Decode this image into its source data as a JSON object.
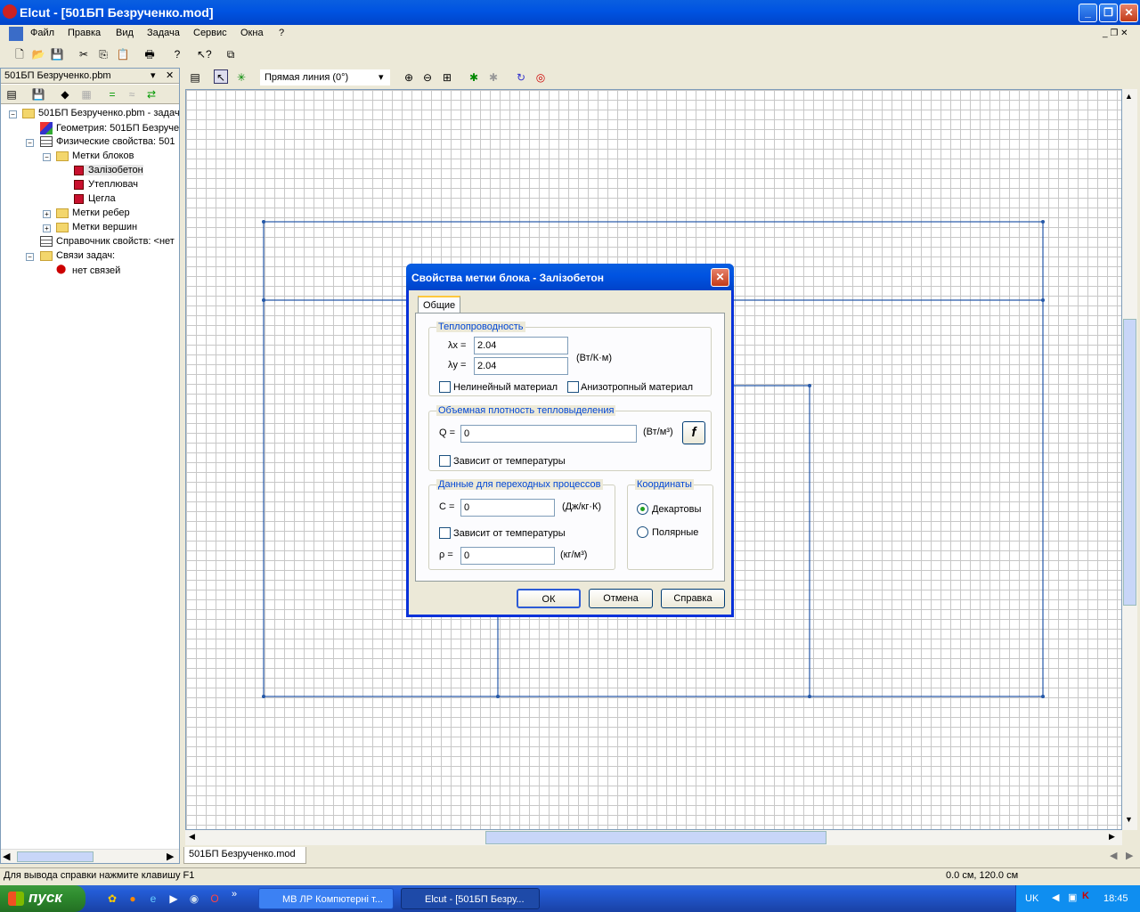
{
  "window": {
    "title": "Elcut - [501БП Безрученко.mod]",
    "min": "0",
    "max": "1",
    "close": "r"
  },
  "menu": [
    "Файл",
    "Правка",
    "Вид",
    "Задача",
    "Сервис",
    "Окна",
    "?"
  ],
  "tree": {
    "header": "501БП Безрученко.pbm",
    "items": [
      "501БП Безрученко.pbm - задач",
      "Геометрия: 501БП Безруче",
      "Физические свойства: 501",
      "Метки блоков",
      "Залізобетон",
      "Утеплювач",
      "Цегла",
      "Метки ребер",
      "Метки вершин",
      "Справочник свойств: <нет",
      "Связи задач:",
      "нет связей"
    ]
  },
  "canvas_toolbar": {
    "line_mode": "Прямая линия (0°)"
  },
  "doc_tab": "501БП Безрученко.mod",
  "status": {
    "help": "Для вывода справки нажмите клавишу F1",
    "coords": "0.0 см, 120.0 см"
  },
  "taskbar": {
    "start": "пуск",
    "tasks": [
      "МВ ЛР Компютерні т...",
      "Elcut - [501БП Безру..."
    ],
    "lang": "UK",
    "time": "18:45"
  },
  "dialog": {
    "title": "Свойства метки блока - Залізобетон",
    "tab": "Общие",
    "thermal": {
      "label": "Теплопроводность",
      "lx_label": "λx =",
      "ly_label": "λy =",
      "lx": "2.04",
      "ly": "2.04",
      "unit": "(Вт/К·м)",
      "nonlinear": "Нелинейный материал",
      "anisotropic": "Анизотропный материал"
    },
    "heat": {
      "label": "Объемная плотность тепловыделения",
      "q_label": "Q =",
      "q": "0",
      "unit": "(Вт/м³)",
      "f_btn": "f",
      "temp_dep": "Зависит от температуры"
    },
    "transient": {
      "label": "Данные для переходных процессов",
      "c_label": "C =",
      "c": "0",
      "c_unit": "(Дж/кг·К)",
      "temp_dep": "Зависит от температуры",
      "rho_label": "ρ =",
      "rho": "0",
      "rho_unit": "(кг/м³)"
    },
    "coords": {
      "label": "Координаты",
      "cartesian": "Декартовы",
      "polar": "Полярные"
    },
    "buttons": {
      "ok": "ОК",
      "cancel": "Отмена",
      "help": "Справка"
    }
  }
}
